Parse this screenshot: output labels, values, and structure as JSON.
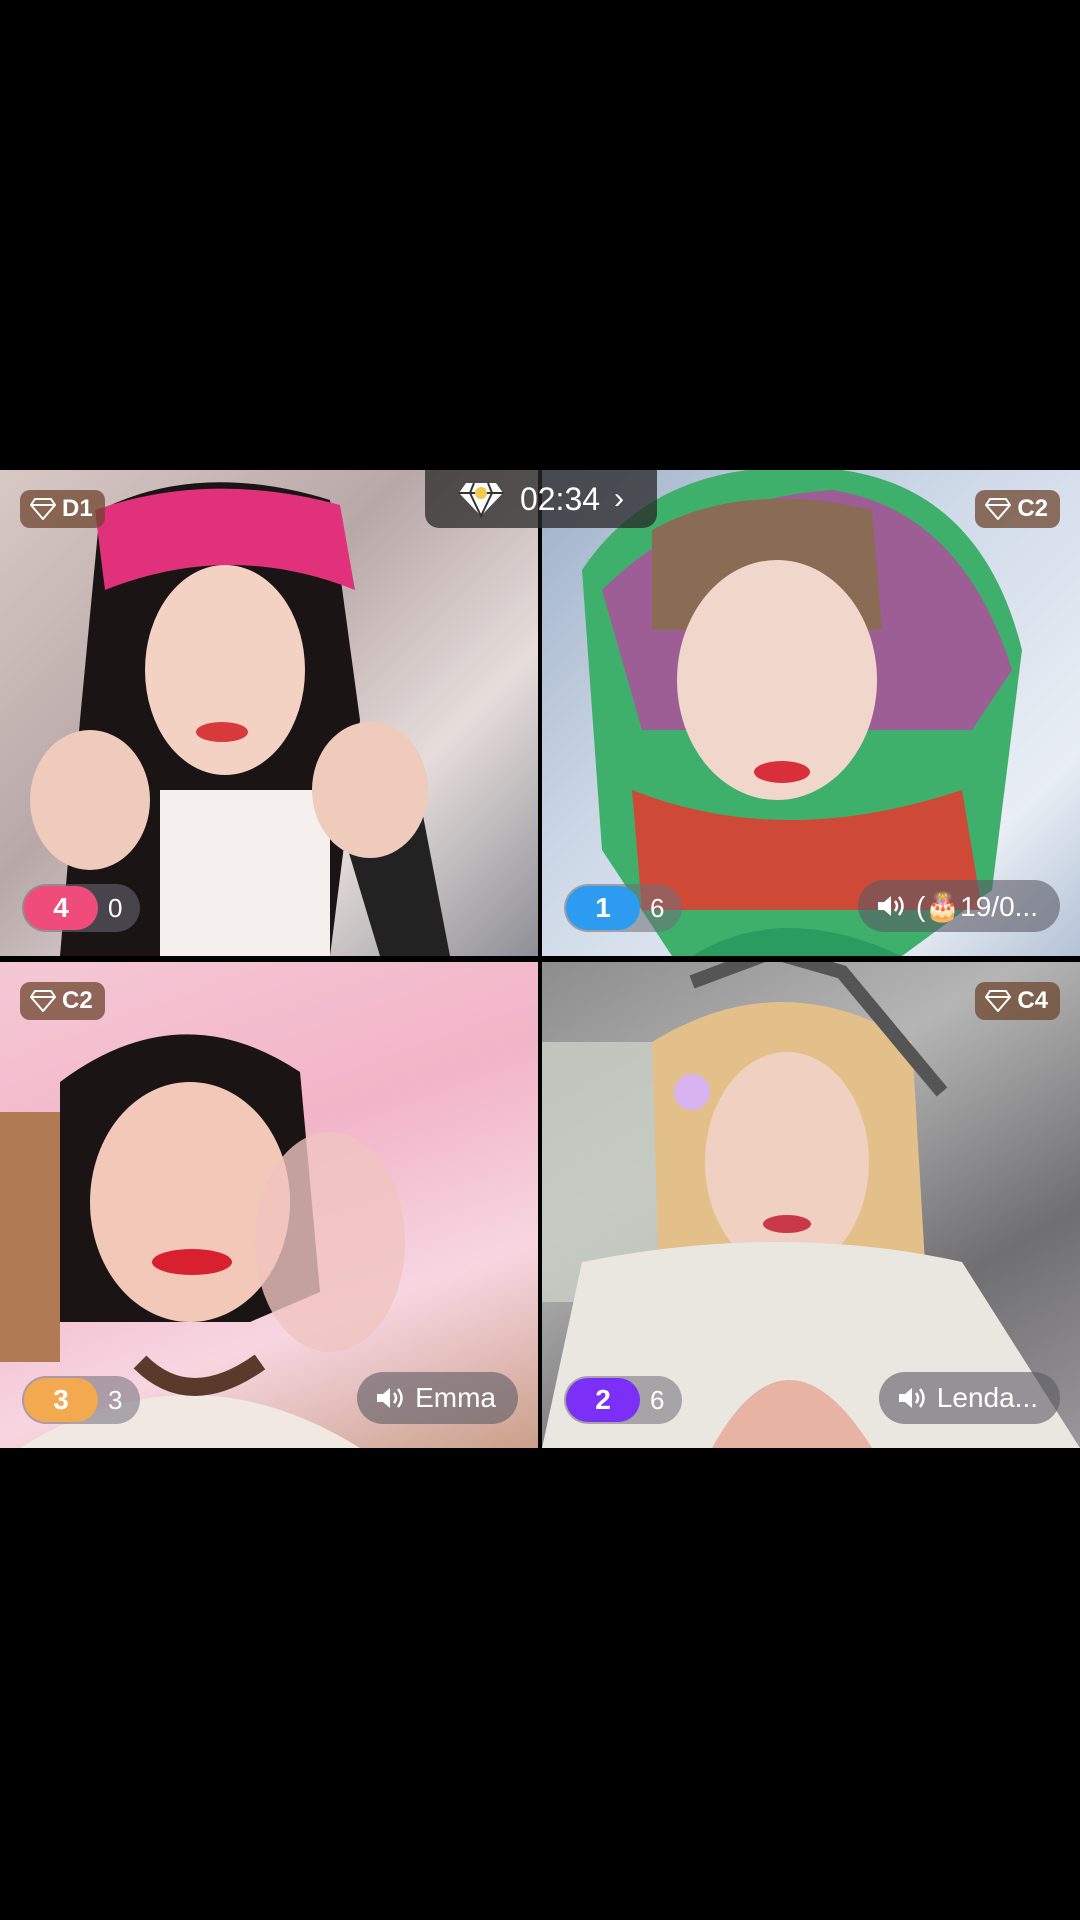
{
  "timer": {
    "time": "02:34",
    "icon": "diamond-icon",
    "chevron": "chevron-right-icon"
  },
  "tiles": [
    {
      "rank": "D1",
      "score_rank": "4",
      "score_value": "0",
      "score_color": "#ef4c7b",
      "name": ""
    },
    {
      "rank": "C2",
      "score_rank": "1",
      "score_value": "6",
      "score_color": "#2d9bf0",
      "name": "(🎂19/0..."
    },
    {
      "rank": "C2",
      "score_rank": "3",
      "score_value": "3",
      "score_color": "#f3a94f",
      "name": "Emma"
    },
    {
      "rank": "C4",
      "score_rank": "2",
      "score_value": "6",
      "score_color": "#7b2ff7",
      "name": "Lenda..."
    }
  ]
}
